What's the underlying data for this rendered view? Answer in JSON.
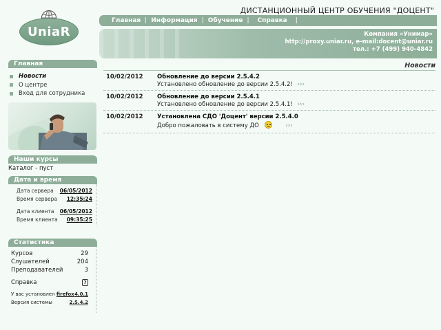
{
  "logo": {
    "text": "UniaR"
  },
  "site_title": "ДИСТАНЦИОННЫЙ ЦЕНТР ОБУЧЕНИЯ \"ДОЦЕНТ\"",
  "topnav": {
    "items": [
      {
        "label": "Главная"
      },
      {
        "label": "Информация"
      },
      {
        "label": "Обучение"
      },
      {
        "label": "Справка"
      }
    ]
  },
  "banner": {
    "company": "Компания «Унимар»",
    "contacts": "http://proxy.uniar.ru, e-mail:docent@uniar.ru",
    "phone": "тел.: +7 (499) 940-4842"
  },
  "sidebar": {
    "main_title": "Главная",
    "menu": [
      {
        "label": "Новости"
      },
      {
        "label": "О центре"
      },
      {
        "label": "Вход для сотрудника"
      }
    ],
    "courses_title": "Наши курсы",
    "courses_text": "Каталог - пуст",
    "datetime_title": "Дата и время",
    "datetime": {
      "server_date_label": "Дата сервера",
      "server_date": "06/05/2012",
      "server_time_label": "Время сервера",
      "server_time": "12:35:24",
      "client_date_label": "Дата клиента",
      "client_date": "06/05/2012",
      "client_time_label": "Время клиента",
      "client_time": "09:35:25"
    },
    "stats_title": "Статистика",
    "stats": {
      "courses_label": "Курсов",
      "courses": "29",
      "listeners_label": "Слушателей",
      "listeners": "204",
      "teachers_label": "Преподавателей",
      "teachers": "3",
      "help_label": "Справка",
      "browser_label": "У вас установлен",
      "browser_name": "firefox",
      "browser_version": "4.0.1",
      "system_version_label": "Версия системы",
      "system_version": "2.5.4.2"
    }
  },
  "news": {
    "title": "Новости",
    "more_glyph": "›››",
    "items": [
      {
        "date": "10/02/2012",
        "head": "Обновление до версии 2.5.4.2",
        "text": "Установлено обновление до версии 2.5.4.2!"
      },
      {
        "date": "10/02/2012",
        "head": "Обновление до версии 2.5.4.1",
        "text": "Установлено обновление до версии 2.5.4.1!"
      },
      {
        "date": "10/02/2012",
        "head": "Установлена СДО 'Доцент' версии 2.5.4.0",
        "text": "Добро пожаловать в систему ДО"
      }
    ]
  },
  "colors": {
    "accent": "#8fae9a",
    "background": "#f4fbf6"
  }
}
